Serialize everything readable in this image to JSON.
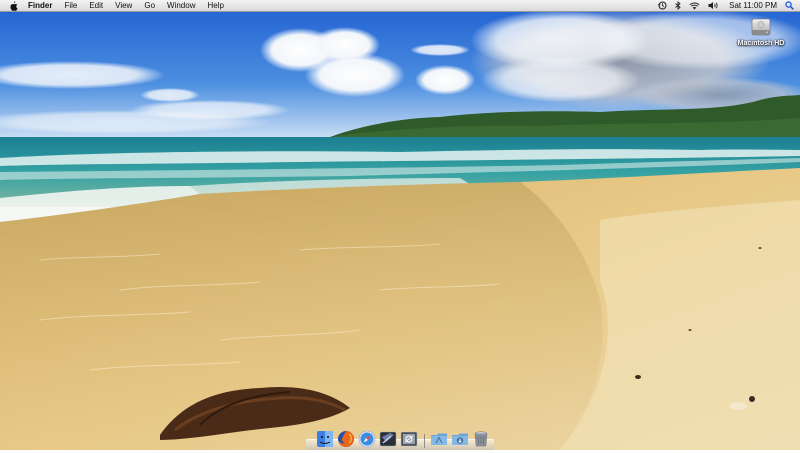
{
  "menubar": {
    "app_name": "Finder",
    "menus": [
      "File",
      "Edit",
      "View",
      "Go",
      "Window",
      "Help"
    ],
    "status_icons": [
      "time-machine-icon",
      "bluetooth-icon",
      "wifi-icon",
      "volume-icon"
    ],
    "clock": "Sat 11:00 PM",
    "spotlight_icon": "spotlight-icon"
  },
  "desktop": {
    "icons": [
      {
        "label": "Macintosh HD",
        "icon": "hard-drive-icon"
      }
    ]
  },
  "dock": {
    "apps": [
      "finder-icon",
      "firefox-icon",
      "safari-icon",
      "terminal-icon",
      "preview-icon"
    ],
    "stacks": [
      "applications-folder-icon",
      "downloads-folder-icon",
      "trash-icon"
    ]
  },
  "colors": {
    "sky_top": "#1f5fd1",
    "sky_horizon": "#cfe1f5",
    "sea": "#2a9a9c",
    "sand": "#e4c47c",
    "menubar": "#e6e6e6"
  }
}
